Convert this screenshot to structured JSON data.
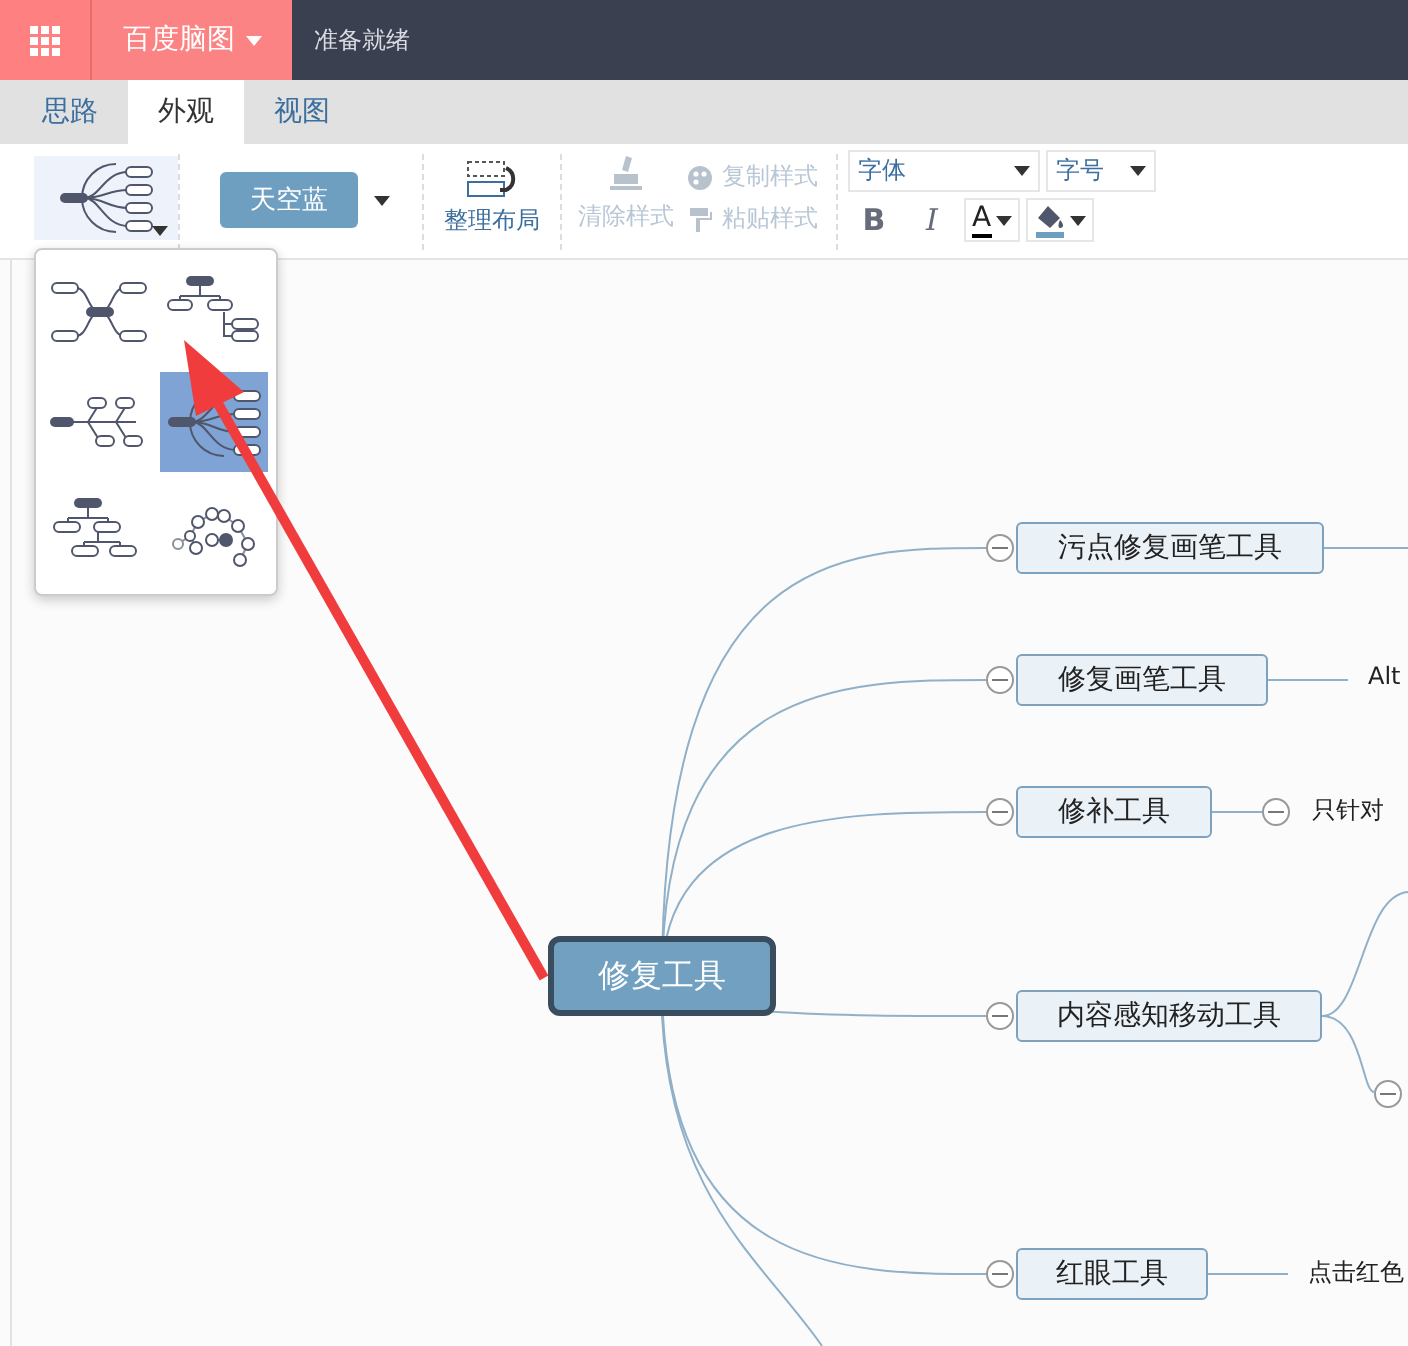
{
  "topbar": {
    "brand": "百度脑图",
    "status": "准备就绪"
  },
  "tabs": [
    {
      "label": "思路",
      "selected": false
    },
    {
      "label": "外观",
      "selected": true
    },
    {
      "label": "视图",
      "selected": false
    }
  ],
  "toolbar": {
    "theme": "天空蓝",
    "arrange": "整理布局",
    "font": "字体",
    "font_size": "字号",
    "bold": "B",
    "italic": "I",
    "font_color": "A",
    "style_actions": [
      {
        "kind": "clear",
        "label": "清除样式",
        "disabled": true
      },
      {
        "kind": "copy",
        "label": "复制样式",
        "disabled": true
      },
      {
        "kind": "paste",
        "label": "粘贴样式",
        "disabled": true
      }
    ]
  },
  "layout_menu": {
    "options": [
      {
        "kind": "mind",
        "selected": false
      },
      {
        "kind": "org-right",
        "selected": false
      },
      {
        "kind": "fish",
        "selected": false
      },
      {
        "kind": "wheel",
        "selected": true
      },
      {
        "kind": "org-down",
        "selected": false
      },
      {
        "kind": "bubble",
        "selected": false
      }
    ]
  },
  "mindmap": {
    "root": "修复工具",
    "branches": [
      {
        "label": "污点修复画笔工具",
        "kind": "line"
      },
      {
        "label": "修复画笔工具",
        "kind": "text",
        "detail": "Alt"
      },
      {
        "label": "修补工具",
        "kind": "collapsible",
        "detail": "只针对"
      },
      {
        "label": "内容感知移动工具",
        "kind": "fork"
      },
      {
        "label": "红眼工具",
        "kind": "text",
        "detail": "点击红色"
      }
    ]
  }
}
